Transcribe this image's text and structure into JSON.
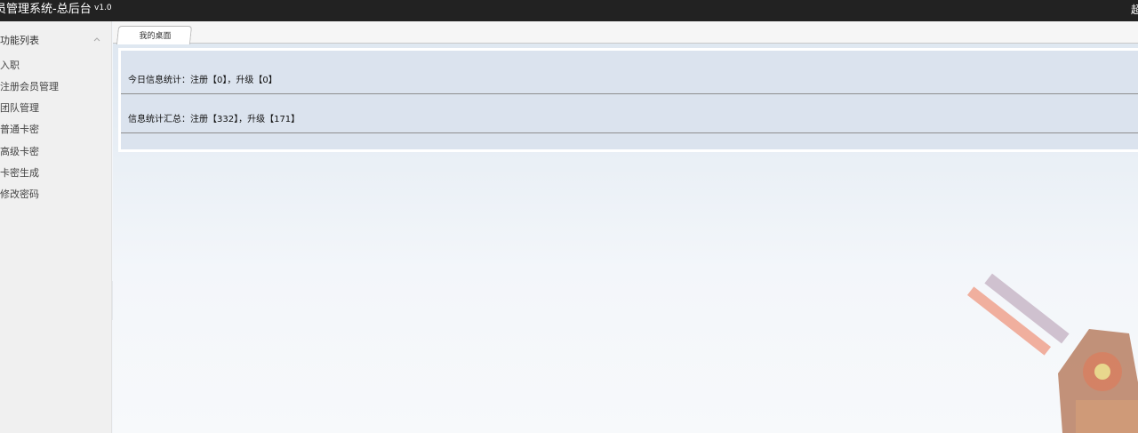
{
  "header": {
    "title": "员管理系统-总后台",
    "version": "v1.0",
    "right_text": "超"
  },
  "sidebar": {
    "title": "功能列表",
    "items": [
      {
        "label": "入职"
      },
      {
        "label": "注册会员管理"
      },
      {
        "label": "团队管理"
      },
      {
        "label": "普通卡密"
      },
      {
        "label": "高级卡密"
      },
      {
        "label": "卡密生成"
      },
      {
        "label": "修改密码"
      }
    ]
  },
  "tabs": [
    {
      "label": "我的桌面"
    }
  ],
  "stats": {
    "today": "今日信息统计：注册【0】，升级【0】",
    "total": "信息统计汇总：注册【332】，升级【171】"
  },
  "icons": {
    "collapse": "chevron-up-icon",
    "sidebar_toggle": "caret-left-icon"
  },
  "colors": {
    "topbar": "#222222",
    "sidebar": "#f0f0f0",
    "panel": "#dbe3ee"
  }
}
